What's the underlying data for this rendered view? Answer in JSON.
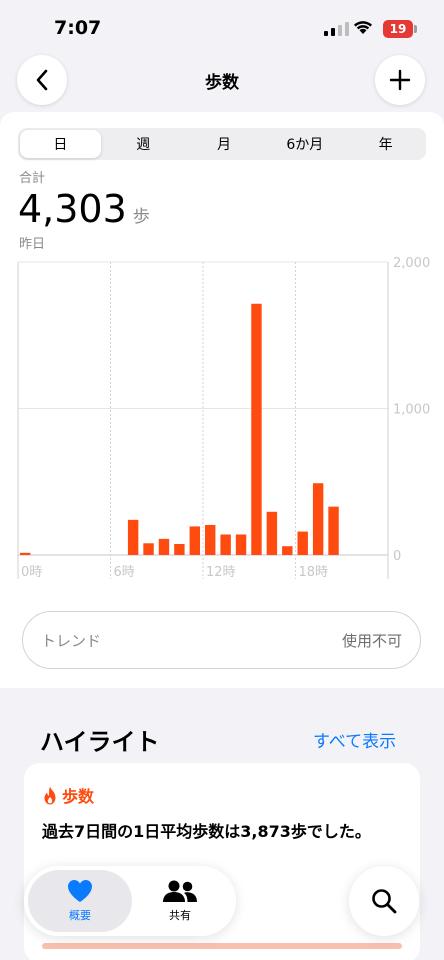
{
  "status_bar": {
    "time": "7:07",
    "battery": "19"
  },
  "nav": {
    "title": "歩数"
  },
  "segments": [
    "日",
    "週",
    "月",
    "6か月",
    "年"
  ],
  "summary": {
    "total_label": "合計",
    "total_value": "4,303",
    "unit": "歩",
    "date": "昨日"
  },
  "chart_data": {
    "type": "bar",
    "x_tick_labels": [
      "0時",
      "6時",
      "12時",
      "18時"
    ],
    "y_tick_labels": [
      "2,000",
      "1,000",
      "0"
    ],
    "ylim": [
      0,
      2000
    ],
    "hours": [
      0,
      1,
      2,
      3,
      4,
      5,
      6,
      7,
      8,
      9,
      10,
      11,
      12,
      13,
      14,
      15,
      16,
      17,
      18,
      19,
      20,
      21,
      22,
      23
    ],
    "values": [
      15,
      0,
      0,
      0,
      0,
      0,
      0,
      240,
      80,
      110,
      75,
      195,
      205,
      140,
      140,
      1715,
      295,
      60,
      160,
      490,
      330,
      0,
      0,
      0
    ],
    "accent": "#ff4b10"
  },
  "trend": {
    "label": "トレンド",
    "status": "使用不可"
  },
  "highlights": {
    "title": "ハイライト",
    "show_all": "すべて表示",
    "card": {
      "tag": "歩数",
      "text": "過去7日間の1日平均歩数は3,873歩でした。"
    }
  },
  "tab_bar": {
    "summary_label": "概要",
    "sharing_label": "共有"
  },
  "colors": {
    "accent": "#ff4b10",
    "link": "#0a7aff"
  }
}
